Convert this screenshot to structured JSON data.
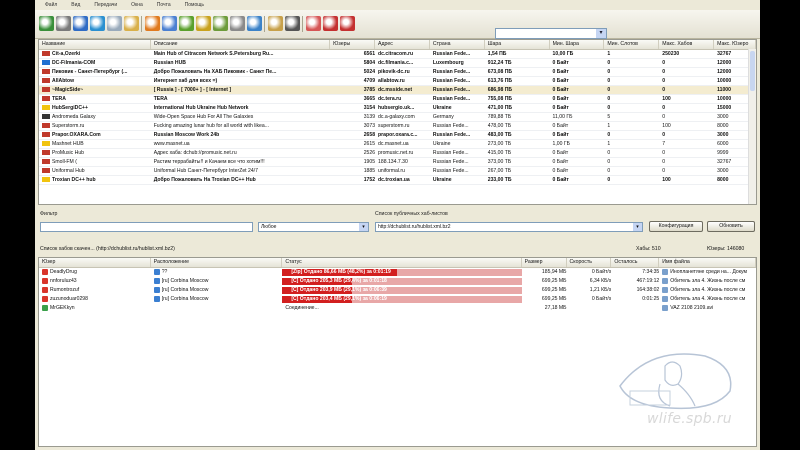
{
  "menubar": [
    "Файл",
    "Вид",
    "Передачи",
    "Окна",
    "Почта",
    "Помощь"
  ],
  "toolbar_icons": [
    "reconnect-icon",
    "settings-icon",
    "globe-icon",
    "refresh-icon",
    "search-icon",
    "queue-icon",
    "favorites-star-icon",
    "users-icon",
    "download-icon",
    "upload-icon",
    "notepad-icon",
    "magnifier-icon",
    "adl-icon",
    "user-icon",
    "hash-icon",
    "highlight-icon",
    "stop-icon",
    "close-icon"
  ],
  "public_hubs": {
    "columns": [
      "Название",
      "Описание",
      "Юзеры",
      "Адрес",
      "Страна",
      "Шара",
      "Мин. Шара",
      "Мин. Слотов",
      "Макс. Хабов",
      "Макс. Юзеро"
    ],
    "rows": [
      {
        "name": "Cit-a,Ozerki",
        "desc": "Main Hub of Citracom Network S.Petersburg Ru...",
        "users": "6561",
        "addr": "dc.citracom.ru",
        "country": "Russian Fede...",
        "share": "1,54 ПБ",
        "minshare": "10,00 ГБ",
        "minslots": "1",
        "maxhubs": "250230",
        "maxusers": "32767",
        "bold": true,
        "flag": "#c0392b"
      },
      {
        "name": "DC-Filmania-COM",
        "desc": "Russian HUB",
        "users": "5804",
        "addr": "dc.filmania.c...",
        "country": "Luxembourg",
        "share": "912,24 ТБ",
        "minshare": "0 Байт",
        "minslots": "0",
        "maxhubs": "0",
        "maxusers": "12000",
        "bold": true,
        "flag": "#1f6fd1"
      },
      {
        "name": "Пиковик - Санкт-Петербург (...",
        "desc": "Добро Пожаловать На ХАБ Пиковик - Санкт Пе...",
        "users": "5024",
        "addr": "pikovik-dc.ru",
        "country": "Russian Fede...",
        "share": "673,08 ПБ",
        "minshare": "0 Байт",
        "minslots": "0",
        "maxhubs": "0",
        "maxusers": "12000",
        "bold": true,
        "flag": "#c0392b"
      },
      {
        "name": "AllAbtow",
        "desc": "Интернет хаб для всех =)",
        "users": "4709",
        "addr": "allabtow.ru",
        "country": "Russian Fede...",
        "share": "613,76 ПБ",
        "minshare": "0 Байт",
        "minslots": "0",
        "maxhubs": "0",
        "maxusers": "10000",
        "bold": true,
        "flag": "#c0392b"
      },
      {
        "name": "~MagicSide~",
        "desc": "[ Russia ] - [ 7000+ ] - [ Internet ]",
        "users": "3785",
        "addr": "dc.msside.net",
        "country": "Russian Fede...",
        "share": "686,98 ПБ",
        "minshare": "0 Байт",
        "minslots": "0",
        "maxhubs": "0",
        "maxusers": "11000",
        "bold": true,
        "flag": "#c0392b",
        "sel": true
      },
      {
        "name": "TERA",
        "desc": "TERA",
        "users": "3665",
        "addr": "dc.tera.ru",
        "country": "Russian Fede...",
        "share": "755,08 ПБ",
        "minshare": "0 Байт",
        "minslots": "0",
        "maxhubs": "100",
        "maxusers": "10000",
        "bold": true,
        "flag": "#c0392b"
      },
      {
        "name": "HubSergiDC++",
        "desc": "International Hub Ukraine Hub Network",
        "users": "3154",
        "addr": "hubsergio.uk...",
        "country": "Ukraine",
        "share": "471,00 ПБ",
        "minshare": "0 Байт",
        "minslots": "0",
        "maxhubs": "0",
        "maxusers": "15000",
        "bold": true,
        "flag": "#f1c40f"
      },
      {
        "name": "Andromeda Galaxy",
        "desc": "Wide-Open Space Hub For All The Galaxies",
        "users": "3139",
        "addr": "dc.a-galaxy.com",
        "country": "Germany",
        "share": "789,88 ТБ",
        "minshare": "11,00 ГБ",
        "minslots": "5",
        "maxhubs": "0",
        "maxusers": "3000",
        "bold": false,
        "flag": "#333"
      },
      {
        "name": "Superstorm.ru",
        "desc": "Fucking amazing lunar hub for all world with likea...",
        "users": "3073",
        "addr": "superstorm.ru",
        "country": "Russian Fede...",
        "share": "478,00 ТБ",
        "minshare": "0 Байт",
        "minslots": "1",
        "maxhubs": "100",
        "maxusers": "8000",
        "bold": false,
        "flag": "#c0392b"
      },
      {
        "name": "Prapor.OXARA.Com",
        "desc": "Russian Moscow Work 24b",
        "users": "2658",
        "addr": "prapor.oxara.c...",
        "country": "Russian Fede...",
        "share": "483,00 ТБ",
        "minshare": "0 Байт",
        "minslots": "0",
        "maxhubs": "0",
        "maxusers": "3000",
        "bold": true,
        "flag": "#c0392b"
      },
      {
        "name": "Mashnet HUB",
        "desc": "www.masnet.ua",
        "users": "2615",
        "addr": "dc.masnet.ua",
        "country": "Ukraine",
        "share": "273,00 ТБ",
        "minshare": "1,00 ГБ",
        "minslots": "1",
        "maxhubs": "7",
        "maxusers": "6000",
        "bold": false,
        "flag": "#f1c40f"
      },
      {
        "name": "ProMusic Hub",
        "desc": "Адрес хаба: dchub://promusic.net.ru",
        "users": "2526",
        "addr": "promusic.net.ru",
        "country": "Russian Fede...",
        "share": "415,00 ТБ",
        "minshare": "0 Байт",
        "minslots": "0",
        "maxhubs": "0",
        "maxusers": "9999",
        "bold": false,
        "flag": "#c0392b"
      },
      {
        "name": "Smoll-FM (",
        "desc": "Растим террабайты!! и Качаем все что хотим!!!",
        "users": "1905",
        "addr": "188.134.7.30",
        "country": "Russian Fede...",
        "share": "373,00 ТБ",
        "minshare": "0 Байт",
        "minslots": "0",
        "maxhubs": "0",
        "maxusers": "32767",
        "bold": false,
        "flag": "#c0392b"
      },
      {
        "name": "Uniformal Hub",
        "desc": "Uniformal Hub Санкт-Петербург InterZet 24/7",
        "users": "1885",
        "addr": "uniformal.ru",
        "country": "Russian Fede...",
        "share": "267,00 ТБ",
        "minshare": "0 Байт",
        "minslots": "0",
        "maxhubs": "0",
        "maxusers": "3000",
        "bold": false,
        "flag": "#c0392b"
      },
      {
        "name": "Troxian DC++ hub",
        "desc": "Добро Пожаловать На Troxian DC++ Hub",
        "users": "1752",
        "addr": "dc.troxian.ua",
        "country": "Ukraine",
        "share": "233,00 ТБ",
        "minshare": "0 Байт",
        "minslots": "0",
        "maxhubs": "100",
        "maxusers": "8000",
        "bold": true,
        "flag": "#f1c40f"
      }
    ]
  },
  "filter": {
    "label": "Фильтр",
    "value": "",
    "field_value": "Любое"
  },
  "hublist": {
    "label": "Список публичных хаб-листов",
    "value": "http://dchublist.ru/hublist.xml.bz2",
    "configure_label": "Конфигурация",
    "refresh_label": "Обновить"
  },
  "status": {
    "text": "Список хабов скачен... (http://dchublist.ru/hublist.xml.bz2)",
    "hubs": "Хабы: 510",
    "users": "Юзеры: 146080"
  },
  "transfers": {
    "columns": [
      "Юзер",
      "Расположение",
      "Статус",
      "Размер",
      "Скорость",
      "Осталось",
      "Имя файла"
    ],
    "rows": [
      {
        "user": "DeadlyDrug",
        "loc": "??",
        "status": "[Zip] Отдано 86,66 МБ (48,2%) за 0:01:19",
        "progress": 0.482,
        "size": "185,94 МБ",
        "speed": "0 Байт/s",
        "left": "7:34:35",
        "file": "Инопланетяне среди на... Докум",
        "color": "#d21f1f"
      },
      {
        "user": "nnforuluz43",
        "loc": "[ru] Corbina Moscow",
        "status": "[C] Отдано 205,3 МБ (29,4%) за 0:01:18",
        "progress": 0.294,
        "size": "699,25 МБ",
        "speed": "6,34 КБ/s",
        "left": "467:19:12",
        "file": "Обитель зла 4. Жизнь после см",
        "color": "#d21f1f"
      },
      {
        "user": "Rumontrozuf",
        "loc": "[ru] Corbina Moscow",
        "status": "[C] Отдано 203,9 МБ (29,1%) за 0:06:39",
        "progress": 0.291,
        "size": "699,25 МБ",
        "speed": "1,21 КБ/s",
        "left": "164:38:02",
        "file": "Обитель зла 4. Жизнь после см",
        "color": "#d21f1f"
      },
      {
        "user": "zuzunoduar0298",
        "loc": "[ru] Corbina Moscow",
        "status": "[C] Отдано 203,4 МБ (29,1%) за 0:06:19",
        "progress": 0.291,
        "size": "699,25 МБ",
        "speed": "0 Байт/s",
        "left": "0:01:25",
        "file": "Обитель зла 4. Жизнь после см",
        "color": "#d21f1f"
      },
      {
        "user": "MrGEKkyn",
        "loc": "",
        "status": "Соединение...",
        "progress": 0,
        "size": "27,18 МБ",
        "speed": "",
        "left": "",
        "file": "VAZ 2108 2109.avi",
        "color": ""
      }
    ]
  },
  "watermark": "wlife.spb.ru"
}
